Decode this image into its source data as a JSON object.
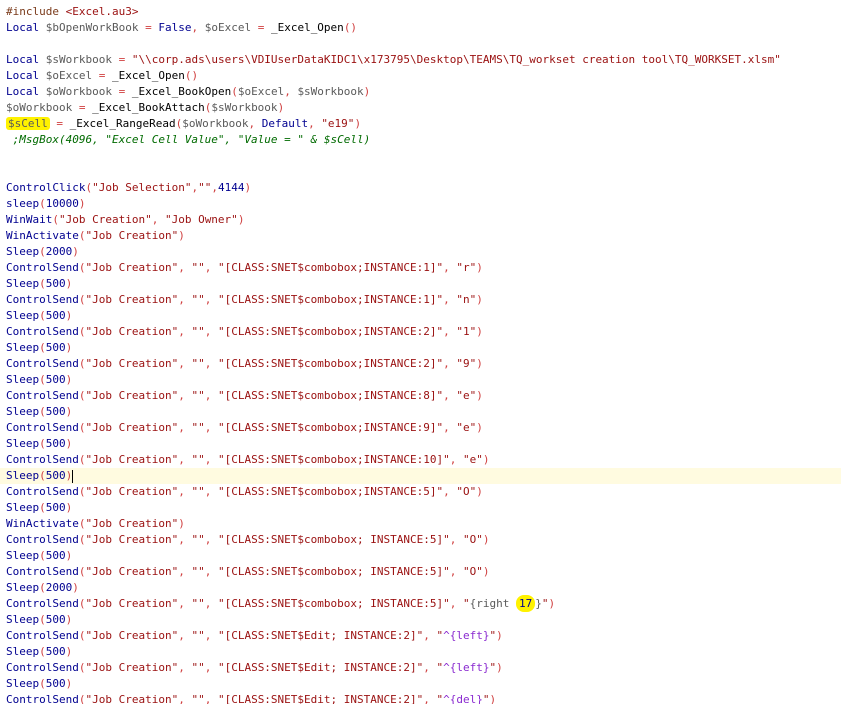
{
  "editor": {
    "lines": [
      [
        {
          "t": "#include ",
          "c": "dir"
        },
        {
          "t": "<Excel.au3>",
          "c": "str"
        }
      ],
      [
        {
          "t": "Local ",
          "c": "kw"
        },
        {
          "t": "$bOpenWorkBook",
          "c": "var"
        },
        {
          "t": " = ",
          "c": "op"
        },
        {
          "t": "False",
          "c": "kw"
        },
        {
          "t": ", ",
          "c": "op"
        },
        {
          "t": "$oExcel",
          "c": "var"
        },
        {
          "t": " = ",
          "c": "op"
        },
        {
          "t": "_Excel_Open",
          "c": "udf"
        },
        {
          "t": "()",
          "c": "op"
        }
      ],
      [],
      [
        {
          "t": "Local ",
          "c": "kw"
        },
        {
          "t": "$sWorkbook",
          "c": "var"
        },
        {
          "t": " = ",
          "c": "op"
        },
        {
          "t": "\"\\\\corp.ads\\users\\VDIUserDataKIDC1\\x173795\\Desktop\\TEAMS\\TQ_workset creation tool\\TQ_WORKSET.xlsm\"",
          "c": "str"
        }
      ],
      [
        {
          "t": "Local ",
          "c": "kw"
        },
        {
          "t": "$oExcel",
          "c": "var"
        },
        {
          "t": " = ",
          "c": "op"
        },
        {
          "t": "_Excel_Open",
          "c": "udf"
        },
        {
          "t": "()",
          "c": "op"
        }
      ],
      [
        {
          "t": "Local ",
          "c": "kw"
        },
        {
          "t": "$oWorkbook",
          "c": "var"
        },
        {
          "t": " = ",
          "c": "op"
        },
        {
          "t": "_Excel_BookOpen",
          "c": "udf"
        },
        {
          "t": "(",
          "c": "op"
        },
        {
          "t": "$oExcel",
          "c": "var"
        },
        {
          "t": ", ",
          "c": "op"
        },
        {
          "t": "$sWorkbook",
          "c": "var"
        },
        {
          "t": ")",
          "c": "op"
        }
      ],
      [
        {
          "t": "$oWorkbook",
          "c": "var"
        },
        {
          "t": " = ",
          "c": "op"
        },
        {
          "t": "_Excel_BookAttach",
          "c": "udf"
        },
        {
          "t": "(",
          "c": "op"
        },
        {
          "t": "$sWorkbook",
          "c": "var"
        },
        {
          "t": ")",
          "c": "op"
        }
      ],
      [
        {
          "t": "$sCell",
          "c": "var",
          "hl": true
        },
        {
          "t": " = ",
          "c": "op"
        },
        {
          "t": "_Excel_RangeRead",
          "c": "udf"
        },
        {
          "t": "(",
          "c": "op"
        },
        {
          "t": "$oWorkbook",
          "c": "var"
        },
        {
          "t": ", ",
          "c": "op"
        },
        {
          "t": "Default",
          "c": "kw"
        },
        {
          "t": ", ",
          "c": "op"
        },
        {
          "t": "\"e19\"",
          "c": "str"
        },
        {
          "t": ")",
          "c": "op"
        }
      ],
      [
        {
          "t": " ;MsgBox(4096, \"Excel Cell Value\", \"Value = \" & $sCell)",
          "c": "cmt"
        }
      ],
      [],
      [],
      [
        {
          "t": "ControlClick",
          "c": "fn"
        },
        {
          "t": "(",
          "c": "op"
        },
        {
          "t": "\"Job Selection\"",
          "c": "str"
        },
        {
          "t": ",",
          "c": "op"
        },
        {
          "t": "\"\"",
          "c": "str"
        },
        {
          "t": ",",
          "c": "op"
        },
        {
          "t": "4144",
          "c": "num"
        },
        {
          "t": ")",
          "c": "op"
        }
      ],
      [
        {
          "t": "sleep",
          "c": "fn"
        },
        {
          "t": "(",
          "c": "op"
        },
        {
          "t": "10000",
          "c": "num"
        },
        {
          "t": ")",
          "c": "op"
        }
      ],
      [
        {
          "t": "WinWait",
          "c": "fn"
        },
        {
          "t": "(",
          "c": "op"
        },
        {
          "t": "\"Job Creation\"",
          "c": "str"
        },
        {
          "t": ", ",
          "c": "op"
        },
        {
          "t": "\"Job Owner\"",
          "c": "str"
        },
        {
          "t": ")",
          "c": "op"
        }
      ],
      [
        {
          "t": "WinActivate",
          "c": "fn"
        },
        {
          "t": "(",
          "c": "op"
        },
        {
          "t": "\"Job Creation\"",
          "c": "str"
        },
        {
          "t": ")",
          "c": "op"
        }
      ],
      [
        {
          "t": "Sleep",
          "c": "fn"
        },
        {
          "t": "(",
          "c": "op"
        },
        {
          "t": "2000",
          "c": "num"
        },
        {
          "t": ")",
          "c": "op"
        }
      ],
      [
        {
          "t": "ControlSend",
          "c": "fn"
        },
        {
          "t": "(",
          "c": "op"
        },
        {
          "t": "\"Job Creation\"",
          "c": "str"
        },
        {
          "t": ", ",
          "c": "op"
        },
        {
          "t": "\"\"",
          "c": "str"
        },
        {
          "t": ", ",
          "c": "op"
        },
        {
          "t": "\"[CLASS:SNET$combobox;INSTANCE:1]\"",
          "c": "str"
        },
        {
          "t": ", ",
          "c": "op"
        },
        {
          "t": "\"r\"",
          "c": "str"
        },
        {
          "t": ")",
          "c": "op"
        }
      ],
      [
        {
          "t": "Sleep",
          "c": "fn"
        },
        {
          "t": "(",
          "c": "op"
        },
        {
          "t": "500",
          "c": "num"
        },
        {
          "t": ")",
          "c": "op"
        }
      ],
      [
        {
          "t": "ControlSend",
          "c": "fn"
        },
        {
          "t": "(",
          "c": "op"
        },
        {
          "t": "\"Job Creation\"",
          "c": "str"
        },
        {
          "t": ", ",
          "c": "op"
        },
        {
          "t": "\"\"",
          "c": "str"
        },
        {
          "t": ", ",
          "c": "op"
        },
        {
          "t": "\"[CLASS:SNET$combobox;INSTANCE:1]\"",
          "c": "str"
        },
        {
          "t": ", ",
          "c": "op"
        },
        {
          "t": "\"n\"",
          "c": "str"
        },
        {
          "t": ")",
          "c": "op"
        }
      ],
      [
        {
          "t": "Sleep",
          "c": "fn"
        },
        {
          "t": "(",
          "c": "op"
        },
        {
          "t": "500",
          "c": "num"
        },
        {
          "t": ")",
          "c": "op"
        }
      ],
      [
        {
          "t": "ControlSend",
          "c": "fn"
        },
        {
          "t": "(",
          "c": "op"
        },
        {
          "t": "\"Job Creation\"",
          "c": "str"
        },
        {
          "t": ", ",
          "c": "op"
        },
        {
          "t": "\"\"",
          "c": "str"
        },
        {
          "t": ", ",
          "c": "op"
        },
        {
          "t": "\"[CLASS:SNET$combobox;INSTANCE:2]\"",
          "c": "str"
        },
        {
          "t": ", ",
          "c": "op"
        },
        {
          "t": "\"1\"",
          "c": "str"
        },
        {
          "t": ")",
          "c": "op"
        }
      ],
      [
        {
          "t": "Sleep",
          "c": "fn"
        },
        {
          "t": "(",
          "c": "op"
        },
        {
          "t": "500",
          "c": "num"
        },
        {
          "t": ")",
          "c": "op"
        }
      ],
      [
        {
          "t": "ControlSend",
          "c": "fn"
        },
        {
          "t": "(",
          "c": "op"
        },
        {
          "t": "\"Job Creation\"",
          "c": "str"
        },
        {
          "t": ", ",
          "c": "op"
        },
        {
          "t": "\"\"",
          "c": "str"
        },
        {
          "t": ", ",
          "c": "op"
        },
        {
          "t": "\"[CLASS:SNET$combobox;INSTANCE:2]\"",
          "c": "str"
        },
        {
          "t": ", ",
          "c": "op"
        },
        {
          "t": "\"9\"",
          "c": "str"
        },
        {
          "t": ")",
          "c": "op"
        }
      ],
      [
        {
          "t": "Sleep",
          "c": "fn"
        },
        {
          "t": "(",
          "c": "op"
        },
        {
          "t": "500",
          "c": "num"
        },
        {
          "t": ")",
          "c": "op"
        }
      ],
      [
        {
          "t": "ControlSend",
          "c": "fn"
        },
        {
          "t": "(",
          "c": "op"
        },
        {
          "t": "\"Job Creation\"",
          "c": "str"
        },
        {
          "t": ", ",
          "c": "op"
        },
        {
          "t": "\"\"",
          "c": "str"
        },
        {
          "t": ", ",
          "c": "op"
        },
        {
          "t": "\"[CLASS:SNET$combobox;INSTANCE:8]\"",
          "c": "str"
        },
        {
          "t": ", ",
          "c": "op"
        },
        {
          "t": "\"e\"",
          "c": "str"
        },
        {
          "t": ")",
          "c": "op"
        }
      ],
      [
        {
          "t": "Sleep",
          "c": "fn"
        },
        {
          "t": "(",
          "c": "op"
        },
        {
          "t": "500",
          "c": "num"
        },
        {
          "t": ")",
          "c": "op"
        }
      ],
      [
        {
          "t": "ControlSend",
          "c": "fn"
        },
        {
          "t": "(",
          "c": "op"
        },
        {
          "t": "\"Job Creation\"",
          "c": "str"
        },
        {
          "t": ", ",
          "c": "op"
        },
        {
          "t": "\"\"",
          "c": "str"
        },
        {
          "t": ", ",
          "c": "op"
        },
        {
          "t": "\"[CLASS:SNET$combobox;INSTANCE:9]\"",
          "c": "str"
        },
        {
          "t": ", ",
          "c": "op"
        },
        {
          "t": "\"e\"",
          "c": "str"
        },
        {
          "t": ")",
          "c": "op"
        }
      ],
      [
        {
          "t": "Sleep",
          "c": "fn"
        },
        {
          "t": "(",
          "c": "op"
        },
        {
          "t": "500",
          "c": "num"
        },
        {
          "t": ")",
          "c": "op"
        }
      ],
      [
        {
          "t": "ControlSend",
          "c": "fn"
        },
        {
          "t": "(",
          "c": "op"
        },
        {
          "t": "\"Job Creation\"",
          "c": "str"
        },
        {
          "t": ", ",
          "c": "op"
        },
        {
          "t": "\"\"",
          "c": "str"
        },
        {
          "t": ", ",
          "c": "op"
        },
        {
          "t": "\"[CLASS:SNET$combobox;INSTANCE:10]\"",
          "c": "str"
        },
        {
          "t": ", ",
          "c": "op"
        },
        {
          "t": "\"e\"",
          "c": "str"
        },
        {
          "t": ")",
          "c": "op"
        }
      ],
      [
        {
          "t": "Sleep",
          "c": "fn"
        },
        {
          "t": "(",
          "c": "op"
        },
        {
          "t": "500",
          "c": "num"
        },
        {
          "t": ")",
          "c": "op"
        },
        {
          "caret": true
        }
      ],
      [
        {
          "t": "ControlSend",
          "c": "fn"
        },
        {
          "t": "(",
          "c": "op"
        },
        {
          "t": "\"Job Creation\"",
          "c": "str"
        },
        {
          "t": ", ",
          "c": "op"
        },
        {
          "t": "\"\"",
          "c": "str"
        },
        {
          "t": ", ",
          "c": "op"
        },
        {
          "t": "\"[CLASS:SNET$combobox;INSTANCE:5]\"",
          "c": "str"
        },
        {
          "t": ", ",
          "c": "op"
        },
        {
          "t": "\"O\"",
          "c": "str"
        },
        {
          "t": ")",
          "c": "op"
        }
      ],
      [
        {
          "t": "Sleep",
          "c": "fn"
        },
        {
          "t": "(",
          "c": "op"
        },
        {
          "t": "500",
          "c": "num"
        },
        {
          "t": ")",
          "c": "op"
        }
      ],
      [
        {
          "t": "WinActivate",
          "c": "fn"
        },
        {
          "t": "(",
          "c": "op"
        },
        {
          "t": "\"Job Creation\"",
          "c": "str"
        },
        {
          "t": ")",
          "c": "op"
        }
      ],
      [
        {
          "t": "ControlSend",
          "c": "fn"
        },
        {
          "t": "(",
          "c": "op"
        },
        {
          "t": "\"Job Creation\"",
          "c": "str"
        },
        {
          "t": ", ",
          "c": "op"
        },
        {
          "t": "\"\"",
          "c": "str"
        },
        {
          "t": ", ",
          "c": "op"
        },
        {
          "t": "\"[CLASS:SNET$combobox; INSTANCE:5]\"",
          "c": "str"
        },
        {
          "t": ", ",
          "c": "op"
        },
        {
          "t": "\"O\"",
          "c": "str"
        },
        {
          "t": ")",
          "c": "op"
        }
      ],
      [
        {
          "t": "Sleep",
          "c": "fn"
        },
        {
          "t": "(",
          "c": "op"
        },
        {
          "t": "500",
          "c": "num"
        },
        {
          "t": ")",
          "c": "op"
        }
      ],
      [
        {
          "t": "ControlSend",
          "c": "fn"
        },
        {
          "t": "(",
          "c": "op"
        },
        {
          "t": "\"Job Creation\"",
          "c": "str"
        },
        {
          "t": ", ",
          "c": "op"
        },
        {
          "t": "\"\"",
          "c": "str"
        },
        {
          "t": ", ",
          "c": "op"
        },
        {
          "t": "\"[CLASS:SNET$combobox; INSTANCE:5]\"",
          "c": "str"
        },
        {
          "t": ", ",
          "c": "op"
        },
        {
          "t": "\"O\"",
          "c": "str"
        },
        {
          "t": ")",
          "c": "op"
        }
      ],
      [
        {
          "t": "Sleep",
          "c": "fn"
        },
        {
          "t": "(",
          "c": "op"
        },
        {
          "t": "2000",
          "c": "num"
        },
        {
          "t": ")",
          "c": "op"
        }
      ],
      [
        {
          "t": "ControlSend",
          "c": "fn"
        },
        {
          "t": "(",
          "c": "op"
        },
        {
          "t": "\"Job Creation\"",
          "c": "str"
        },
        {
          "t": ", ",
          "c": "op"
        },
        {
          "t": "\"\"",
          "c": "str"
        },
        {
          "t": ", ",
          "c": "op"
        },
        {
          "t": "\"[CLASS:SNET$combobox; INSTANCE:5]\"",
          "c": "str"
        },
        {
          "t": ", ",
          "c": "op"
        },
        {
          "t": "\"",
          "c": "str"
        },
        {
          "t": "{right ",
          "c": "var"
        },
        {
          "t": "17",
          "c": "num",
          "hlbig": true
        },
        {
          "t": "}",
          "c": "var"
        },
        {
          "t": "\"",
          "c": "str"
        },
        {
          "t": ")",
          "c": "op"
        }
      ],
      [
        {
          "t": "Sleep",
          "c": "fn"
        },
        {
          "t": "(",
          "c": "op"
        },
        {
          "t": "500",
          "c": "num"
        },
        {
          "t": ")",
          "c": "op"
        }
      ],
      [
        {
          "t": "ControlSend",
          "c": "fn"
        },
        {
          "t": "(",
          "c": "op"
        },
        {
          "t": "\"Job Creation\"",
          "c": "str"
        },
        {
          "t": ", ",
          "c": "op"
        },
        {
          "t": "\"\"",
          "c": "str"
        },
        {
          "t": ", ",
          "c": "op"
        },
        {
          "t": "\"[CLASS:SNET$Edit; INSTANCE:2]\"",
          "c": "str"
        },
        {
          "t": ", ",
          "c": "op"
        },
        {
          "t": "\"",
          "c": "str"
        },
        {
          "t": "^{left}",
          "c": "macro"
        },
        {
          "t": "\"",
          "c": "str"
        },
        {
          "t": ")",
          "c": "op"
        }
      ],
      [
        {
          "t": "Sleep",
          "c": "fn"
        },
        {
          "t": "(",
          "c": "op"
        },
        {
          "t": "500",
          "c": "num"
        },
        {
          "t": ")",
          "c": "op"
        }
      ],
      [
        {
          "t": "ControlSend",
          "c": "fn"
        },
        {
          "t": "(",
          "c": "op"
        },
        {
          "t": "\"Job Creation\"",
          "c": "str"
        },
        {
          "t": ", ",
          "c": "op"
        },
        {
          "t": "\"\"",
          "c": "str"
        },
        {
          "t": ", ",
          "c": "op"
        },
        {
          "t": "\"[CLASS:SNET$Edit; INSTANCE:2]\"",
          "c": "str"
        },
        {
          "t": ", ",
          "c": "op"
        },
        {
          "t": "\"",
          "c": "str"
        },
        {
          "t": "^{left}",
          "c": "macro"
        },
        {
          "t": "\"",
          "c": "str"
        },
        {
          "t": ")",
          "c": "op"
        }
      ],
      [
        {
          "t": "Sleep",
          "c": "fn"
        },
        {
          "t": "(",
          "c": "op"
        },
        {
          "t": "500",
          "c": "num"
        },
        {
          "t": ")",
          "c": "op"
        }
      ],
      [
        {
          "t": "ControlSend",
          "c": "fn"
        },
        {
          "t": "(",
          "c": "op"
        },
        {
          "t": "\"Job Creation\"",
          "c": "str"
        },
        {
          "t": ", ",
          "c": "op"
        },
        {
          "t": "\"\"",
          "c": "str"
        },
        {
          "t": ", ",
          "c": "op"
        },
        {
          "t": "\"[CLASS:SNET$Edit; INSTANCE:2]\"",
          "c": "str"
        },
        {
          "t": ", ",
          "c": "op"
        },
        {
          "t": "\"",
          "c": "str"
        },
        {
          "t": "^{del}",
          "c": "macro"
        },
        {
          "t": "\"",
          "c": "str"
        },
        {
          "t": ")",
          "c": "op"
        }
      ]
    ],
    "current_line": 29
  }
}
